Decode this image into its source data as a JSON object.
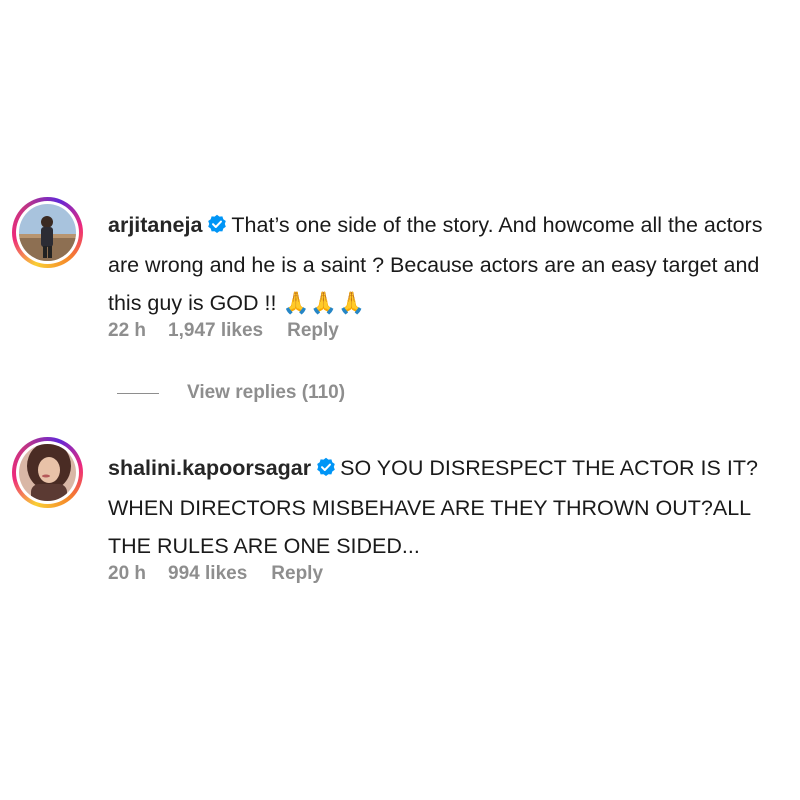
{
  "comments": [
    {
      "username": "arjitaneja",
      "verified": true,
      "text": "That’s one side of the story. And howcome all the actors are wrong and he is a saint ? Because actors are an easy target and this guy is GOD !! ",
      "emoji": "🙏🙏🙏",
      "time": "22 h",
      "likes": "1,947 likes",
      "reply_label": "Reply"
    },
    {
      "username": "shalini.kapoorsagar",
      "verified": true,
      "text": "SO YOU DISRESPECT THE ACTOR IS IT? WHEN DIRECTORS MISBEHAVE ARE THEY THROWN OUT?ALL THE RULES ARE ONE SIDED...",
      "time": "20 h",
      "likes": "994 likes",
      "reply_label": "Reply"
    }
  ],
  "view_replies": "View replies (110)",
  "colors": {
    "meta_gray": "#8e8e8e",
    "verified_blue": "#0095f6",
    "text": "#1a1a1a"
  }
}
